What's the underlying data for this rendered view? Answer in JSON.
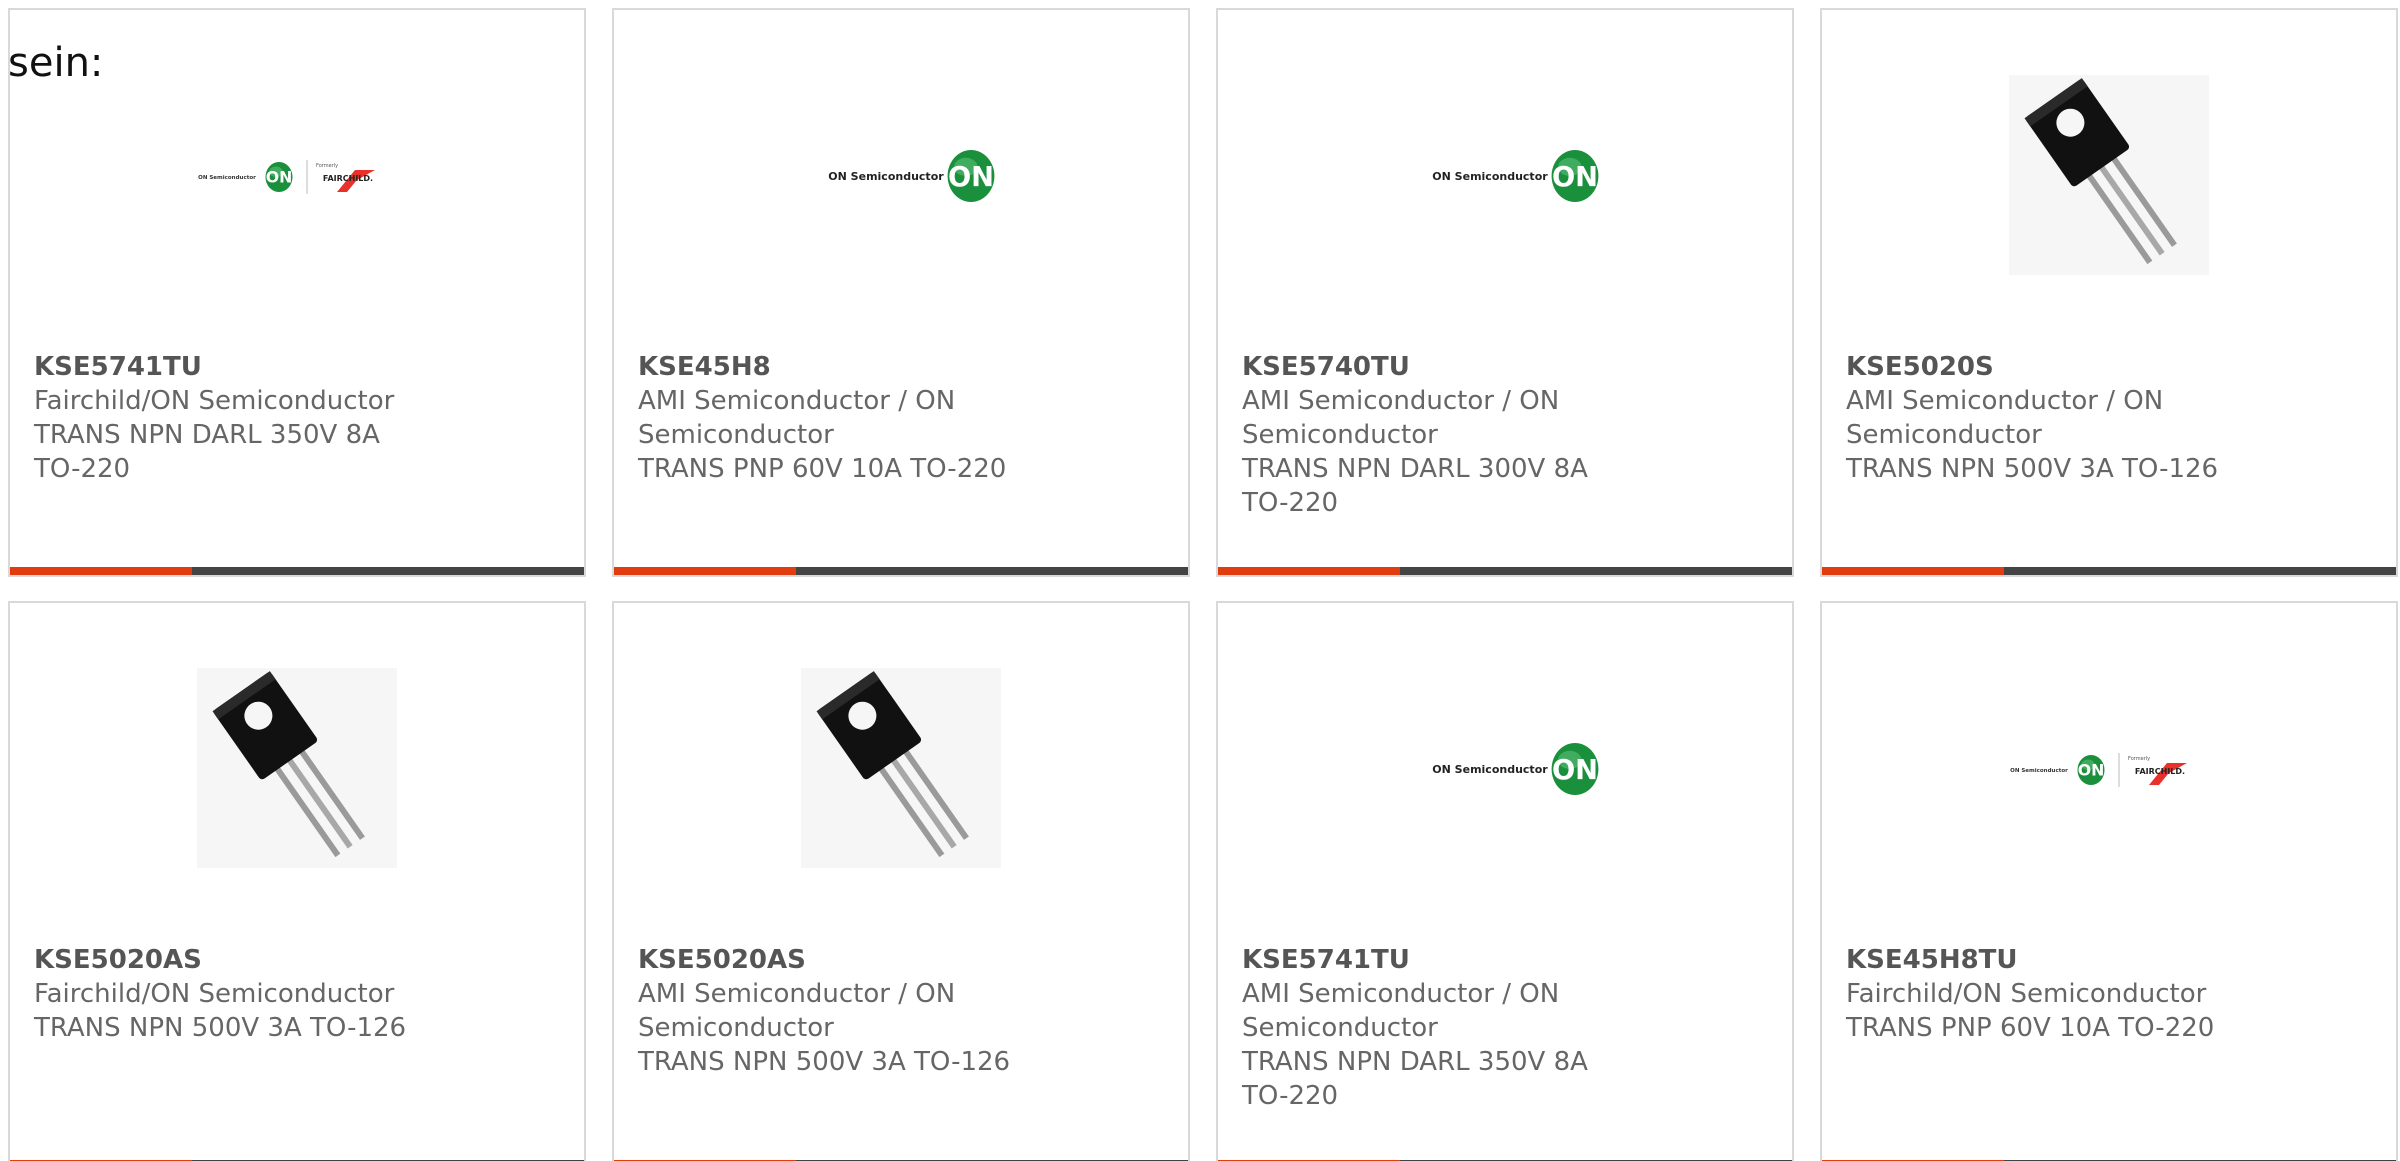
{
  "intro_text": "sein:",
  "colors": {
    "accent": "#e03c10",
    "bar": "#444444",
    "border": "#d9d9d9",
    "on_green": "#1a8f3c"
  },
  "logo": {
    "on_text": "ON Semiconductor",
    "on_badge": "ON",
    "formerly_text": "Formerly",
    "fairchild_text": "FAIRCHILD."
  },
  "cards": [
    {
      "image": "on-fairchild-logo",
      "part_number": "KSE5741TU",
      "manufacturer": "Fairchild/ON Semiconductor",
      "description": "TRANS NPN DARL 350V 8A TO-220"
    },
    {
      "image": "on-semiconductor-logo",
      "part_number": "KSE45H8",
      "manufacturer": "AMI Semiconductor / ON Semiconductor",
      "description": "TRANS PNP 60V 10A TO-220"
    },
    {
      "image": "on-semiconductor-logo",
      "part_number": "KSE5740TU",
      "manufacturer": "AMI Semiconductor / ON Semiconductor",
      "description": "TRANS NPN DARL 300V 8A TO-220"
    },
    {
      "image": "to-126-transistor-photo",
      "part_number": "KSE5020S",
      "manufacturer": "AMI Semiconductor / ON Semiconductor",
      "description": "TRANS NPN 500V 3A TO-126"
    },
    {
      "image": "to-126-transistor-photo",
      "part_number": "KSE5020AS",
      "manufacturer": "Fairchild/ON Semiconductor",
      "description": "TRANS NPN 500V 3A TO-126"
    },
    {
      "image": "to-126-transistor-photo",
      "part_number": "KSE5020AS",
      "manufacturer": "AMI Semiconductor / ON Semiconductor",
      "description": "TRANS NPN 500V 3A TO-126"
    },
    {
      "image": "on-semiconductor-logo",
      "part_number": "KSE5741TU",
      "manufacturer": "AMI Semiconductor / ON Semiconductor",
      "description": "TRANS NPN DARL 350V 8A TO-220"
    },
    {
      "image": "on-fairchild-logo",
      "part_number": "KSE45H8TU",
      "manufacturer": "Fairchild/ON Semiconductor",
      "description": "TRANS PNP 60V 10A TO-220"
    }
  ]
}
